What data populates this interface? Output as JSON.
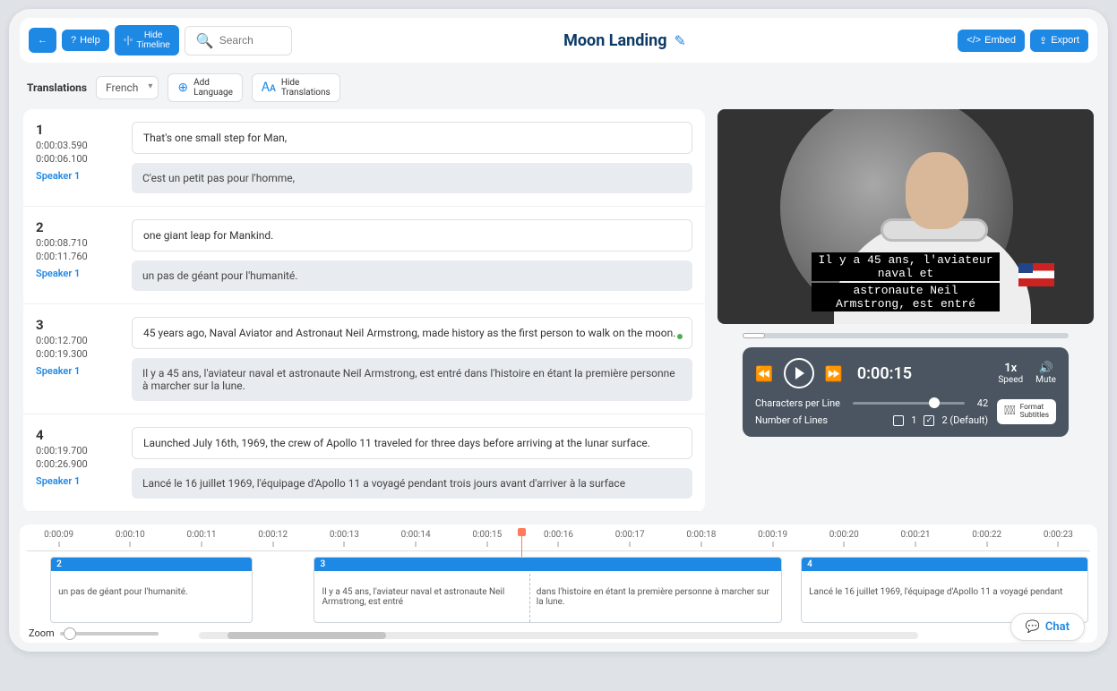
{
  "topbar": {
    "back_label": "",
    "help_label": "Help",
    "timeline_l1": "Hide",
    "timeline_l2": "Timeline",
    "search_placeholder": "Search",
    "title": "Moon Landing",
    "embed_label": "Embed",
    "export_label": "Export"
  },
  "subbar": {
    "translations_label": "Translations",
    "language": "French",
    "add_l1": "Add",
    "add_l2": "Language",
    "hide_l1": "Hide",
    "hide_l2": "Translations"
  },
  "segments": [
    {
      "num": "1",
      "start": "0:00:03.590",
      "end": "0:00:06.100",
      "speaker": "Speaker 1",
      "text": "That's one small step for Man,",
      "translation": "C'est un petit pas pour l'homme,"
    },
    {
      "num": "2",
      "start": "0:00:08.710",
      "end": "0:00:11.760",
      "speaker": "Speaker 1",
      "text": "one giant leap for Mankind.",
      "translation": "un pas de géant pour l'humanité."
    },
    {
      "num": "3",
      "start": "0:00:12.700",
      "end": "0:00:19.300",
      "speaker": "Speaker 1",
      "text": "45 years ago, Naval Aviator and Astronaut Neil Armstrong, made history as the first person to walk on the moon.",
      "translation": "Il y a 45 ans, l'aviateur naval et astronaute Neil Armstrong, est entré dans l'histoire en étant la première personne à marcher sur la lune.",
      "active": true
    },
    {
      "num": "4",
      "start": "0:00:19.700",
      "end": "0:00:26.900",
      "speaker": "Speaker 1",
      "text": "Launched July 16th, 1969, the crew of Apollo 11 traveled for three days before arriving at the lunar surface.",
      "translation": "Lancé le 16 juillet 1969, l'équipage d'Apollo 11 a voyagé pendant trois jours avant d'arriver à la surface"
    }
  ],
  "video": {
    "subtitle_line1": "Il y a 45 ans, l'aviateur naval et",
    "subtitle_line2": "astronaute Neil Armstrong, est entré"
  },
  "player": {
    "time": "0:00:15",
    "speed_val": "1x",
    "speed_label": "Speed",
    "mute_label": "Mute",
    "cpl_label": "Characters per Line",
    "cpl_value": "42",
    "nol_label": "Number of Lines",
    "nol_opt1": "1",
    "nol_opt2": "2 (Default)",
    "format_l1": "Format",
    "format_l2": "Subtitles"
  },
  "timeline": {
    "ticks": [
      "0:00:09",
      "0:00:10",
      "0:00:11",
      "0:00:12",
      "0:00:13",
      "0:00:14",
      "0:00:15",
      "0:00:16",
      "0:00:17",
      "0:00:18",
      "0:00:19",
      "0:00:20",
      "0:00:21",
      "0:00:22",
      "0:00:23"
    ],
    "zoom_label": "Zoom",
    "clips": [
      {
        "num": "2",
        "text": "un pas de géant pour l'humanité."
      },
      {
        "num": "3",
        "textA": "Il y a 45 ans, l'aviateur naval et astronaute Neil Armstrong, est entré",
        "textB": "dans l'histoire en étant la première personne à marcher sur la lune."
      },
      {
        "num": "4",
        "text": "Lancé le 16 juillet 1969, l'équipage d'Apollo 11 a voyagé pendant"
      }
    ]
  },
  "chat_label": "Chat"
}
